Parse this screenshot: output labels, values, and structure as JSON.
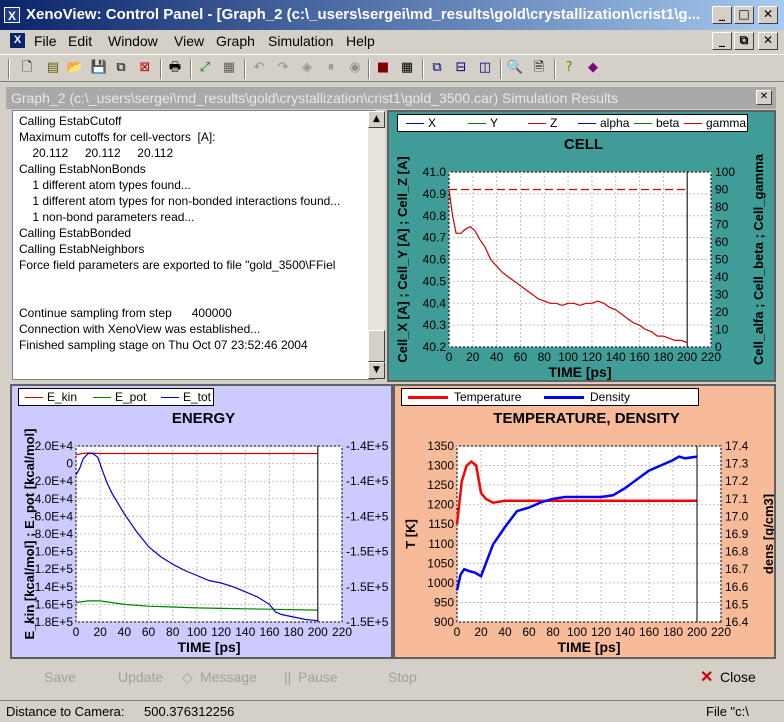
{
  "window": {
    "title": "XenoView: Control Panel - [Graph_2  (c:\\_users\\sergei\\md_results\\gold\\crystallization\\crist1\\g...",
    "app_icon": "xenoview-icon",
    "controls": [
      "minimize-icon",
      "restore-icon",
      "close-icon"
    ]
  },
  "menu": {
    "items": [
      "File",
      "Edit",
      "Window",
      "View",
      "Graph",
      "Simulation",
      "Help"
    ],
    "mdi_controls": [
      "minimize-icon",
      "restore-icon",
      "close-icon"
    ]
  },
  "toolbar": {
    "icons": [
      "new-icon",
      "open-folder-icon",
      "save-icon",
      "save-all-icon",
      "close-doc-icon",
      "print-icon",
      "axes-icon",
      "grid-chart-icon",
      "undo-icon",
      "redo-icon",
      "move-icon",
      "pause-icon",
      "camera-icon",
      "image-icon",
      "table-icon",
      "cascade-icon",
      "tile-horizontal-icon",
      "tile-vertical-icon",
      "zoom-icon",
      "preview-icon",
      "help-icon",
      "about-icon"
    ]
  },
  "child_window": {
    "title": "Graph_2  (c:\\_users\\sergei\\md_results\\gold\\crystallization\\crist1\\gold_3500.car) Simulation Results",
    "close_icon": "close-icon"
  },
  "log": {
    "lines": [
      "Calling EstabCutoff",
      "Maximum cutoffs for cell-vectors  [A]:",
      "    20.112     20.112     20.112",
      "Calling EstabNonBonds",
      "    1 different atom types found...",
      "    1 different atom types for non-bonded interactions found...",
      "    1 non-bond parameters read...",
      "Calling EstabBonded",
      "Calling EstabNeighbors",
      "Force field parameters are exported to file \"gold_3500\\FFiel",
      "",
      "",
      "Continue sampling from step      400000",
      "Connection with XenoView was established...",
      "Finished sampling stage on Thu Oct 07 23:52:46 2004"
    ],
    "scroll_up": "scroll-up-icon",
    "scroll_down": "scroll-down-icon"
  },
  "chart_data": [
    {
      "type": "line",
      "title": "CELL",
      "background": "#3f9c96",
      "legend": [
        "X",
        "Y",
        "Z",
        "alpha",
        "beta",
        "gamma"
      ],
      "legend_colors": [
        "#0000cc",
        "#008000",
        "#cc0000",
        "#0000cc",
        "#008000",
        "#cc0000"
      ],
      "xlabel": "TIME [ps]",
      "ylabel": "Cell_X [A] ; Cell_Y [A] ; Cell_Z [A]",
      "y2label": "Cell_alfa ; Cell_beta ; Cell_gamma",
      "xlim": [
        0,
        220
      ],
      "ylim": [
        40.2,
        41.0
      ],
      "y2lim": [
        0,
        100
      ],
      "xticks": [
        "0",
        "20",
        "40",
        "60",
        "80",
        "100",
        "120",
        "140",
        "160",
        "180",
        "200",
        "220"
      ],
      "yticks": [
        "40.2",
        "40.3",
        "40.4",
        "40.5",
        "40.6",
        "40.7",
        "40.8",
        "40.9",
        "41.0"
      ],
      "y2ticks": [
        "0",
        "10",
        "20",
        "30",
        "40",
        "50",
        "60",
        "70",
        "80",
        "90",
        "100"
      ],
      "series": [
        {
          "name": "X",
          "color": "#cc0000",
          "x": [
            0,
            3,
            6,
            10,
            14,
            18,
            22,
            26,
            30,
            35,
            40,
            45,
            50,
            55,
            60,
            65,
            70,
            75,
            80,
            85,
            90,
            95,
            100,
            105,
            110,
            115,
            120,
            125,
            130,
            135,
            140,
            145,
            150,
            155,
            160,
            165,
            170,
            175,
            180,
            185,
            190,
            195,
            200
          ],
          "y": [
            40.92,
            40.8,
            40.72,
            40.72,
            40.74,
            40.75,
            40.73,
            40.69,
            40.66,
            40.6,
            40.57,
            40.54,
            40.52,
            40.5,
            40.48,
            40.46,
            40.44,
            40.42,
            40.41,
            40.4,
            40.4,
            40.39,
            40.4,
            40.4,
            40.39,
            40.4,
            40.4,
            40.41,
            40.4,
            40.38,
            40.37,
            40.35,
            40.33,
            40.31,
            40.3,
            40.28,
            40.27,
            40.25,
            40.25,
            40.24,
            40.23,
            40.23,
            40.22
          ]
        },
        {
          "name": "gamma",
          "color": "#cc0000",
          "dashed": true,
          "x": [
            0,
            200
          ],
          "y2": [
            90,
            90
          ]
        }
      ]
    },
    {
      "type": "line",
      "title": "ENERGY",
      "background": "#cccaff",
      "legend": [
        "E_kin",
        "E_pot",
        "E_tot"
      ],
      "legend_colors": [
        "#cc0000",
        "#008000",
        "#0000cc"
      ],
      "xlabel": "TIME [ps]",
      "ylabel": "E_kin [kcal/mol] ; E_pot [kcal/mol]",
      "y2label": "",
      "xlim": [
        0,
        220
      ],
      "ylim": [
        -180000,
        20000
      ],
      "y2lim": [
        -153000,
        -139000
      ],
      "xticks": [
        "0",
        "20",
        "40",
        "60",
        "80",
        "100",
        "120",
        "140",
        "160",
        "180",
        "200",
        "220"
      ],
      "yticks": [
        "-1.8E+5",
        "-1.6E+5",
        "-1.4E+5",
        "-1.2E+5",
        "-1.0E+5",
        "-8.0E+4",
        "-6.0E+4",
        "-4.0E+4",
        "-2.0E+4",
        "0",
        "2.0E+4"
      ],
      "y2ticks": [
        "-1.5E+5",
        "-1.5E+5",
        "-1.5E+5",
        "-1.4E+5",
        "-1.4E+5",
        "-1.4E+5"
      ],
      "series": [
        {
          "name": "E_kin",
          "color": "#cc0000",
          "x": [
            0,
            5,
            10,
            20,
            40,
            60,
            80,
            100,
            120,
            140,
            160,
            180,
            200
          ],
          "y": [
            10000,
            11500,
            12000,
            11500,
            11500,
            11500,
            11500,
            11500,
            11500,
            11500,
            11500,
            11500,
            11500
          ]
        },
        {
          "name": "E_pot",
          "color": "#008000",
          "x": [
            0,
            10,
            20,
            40,
            60,
            80,
            100,
            120,
            140,
            160,
            180,
            200
          ],
          "y": [
            -158000,
            -156000,
            -156000,
            -160000,
            -162000,
            -163000,
            -164000,
            -164500,
            -165000,
            -165500,
            -166000,
            -166500
          ]
        },
        {
          "name": "E_tot",
          "color": "#0000cc",
          "x": [
            0,
            3,
            6,
            10,
            14,
            18,
            22,
            26,
            30,
            35,
            40,
            45,
            50,
            55,
            60,
            70,
            80,
            90,
            100,
            110,
            120,
            130,
            140,
            150,
            160,
            165,
            170,
            180,
            190,
            200
          ],
          "y2": [
            -141300,
            -140800,
            -140000,
            -139600,
            -139600,
            -139900,
            -141000,
            -142000,
            -142800,
            -143600,
            -144400,
            -145100,
            -145800,
            -146400,
            -147000,
            -147800,
            -148400,
            -148900,
            -149300,
            -149700,
            -149900,
            -150200,
            -150600,
            -151000,
            -151600,
            -152200,
            -152400,
            -152600,
            -152800,
            -152900
          ]
        }
      ]
    },
    {
      "type": "line",
      "title": "TEMPERATURE, DENSITY",
      "background": "#f8bb9a",
      "legend": [
        "Temperature",
        "Density"
      ],
      "legend_colors": [
        "#ff0000",
        "#0000ff"
      ],
      "xlabel": "TIME [ps]",
      "ylabel": "T [K]",
      "y2label": "dens [g/cm3]",
      "xlim": [
        0,
        220
      ],
      "ylim": [
        900,
        1350
      ],
      "y2lim": [
        16.4,
        17.4
      ],
      "xticks": [
        "0",
        "20",
        "40",
        "60",
        "80",
        "100",
        "120",
        "140",
        "160",
        "180",
        "200",
        "220"
      ],
      "yticks": [
        "900",
        "950",
        "1000",
        "1050",
        "1100",
        "1150",
        "1200",
        "1250",
        "1300",
        "1350"
      ],
      "y2ticks": [
        "16.4",
        "16.5",
        "16.6",
        "16.7",
        "16.8",
        "16.9",
        "17.0",
        "17.1",
        "17.2",
        "17.3",
        "17.4"
      ],
      "series": [
        {
          "name": "Temperature",
          "color": "#ff0000",
          "x": [
            0,
            4,
            8,
            12,
            16,
            20,
            24,
            30,
            40,
            60,
            80,
            100,
            120,
            140,
            160,
            180,
            200
          ],
          "y": [
            1150,
            1260,
            1300,
            1310,
            1300,
            1230,
            1215,
            1205,
            1210,
            1210,
            1210,
            1210,
            1210,
            1210,
            1210,
            1210,
            1210
          ]
        },
        {
          "name": "Density",
          "color": "#0000ff",
          "x": [
            0,
            3,
            6,
            10,
            15,
            20,
            25,
            30,
            40,
            50,
            60,
            70,
            80,
            90,
            100,
            110,
            120,
            130,
            140,
            150,
            160,
            170,
            180,
            185,
            190,
            200
          ],
          "y2": [
            16.58,
            16.67,
            16.7,
            16.69,
            16.68,
            16.66,
            16.75,
            16.84,
            16.94,
            17.03,
            17.05,
            17.08,
            17.1,
            17.11,
            17.11,
            17.11,
            17.11,
            17.12,
            17.16,
            17.21,
            17.26,
            17.29,
            17.32,
            17.34,
            17.33,
            17.34
          ]
        }
      ]
    }
  ],
  "bottom_buttons": {
    "save": "Save",
    "update": "Update",
    "message": "Message",
    "pause": "Pause",
    "stop": "Stop",
    "close": "Close",
    "message_icon": "diamond-icon",
    "pause_icon": "pause-icon",
    "close_icon": "red-x-icon"
  },
  "status_bar": {
    "label": "Distance to Camera:",
    "value": "500.376312256",
    "file": "File \"c:\\"
  }
}
